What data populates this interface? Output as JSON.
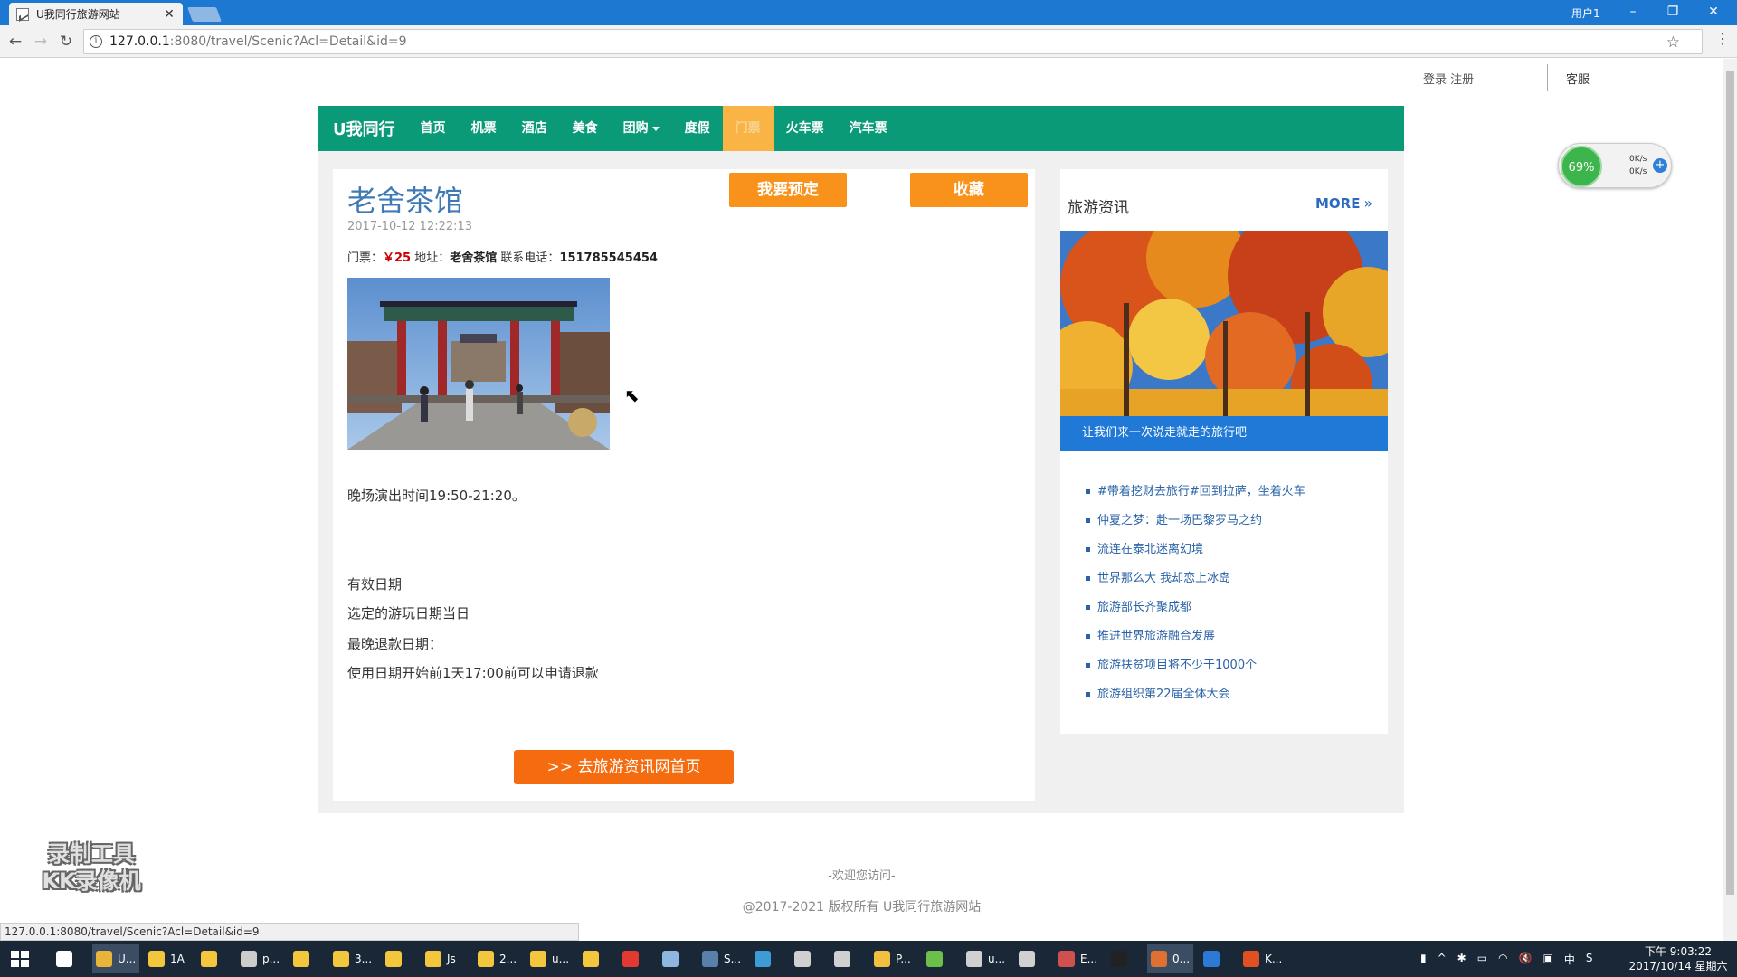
{
  "browser": {
    "tab_title": "U我同行旅游网站",
    "tab_close": "✕",
    "window_user": "用户1",
    "minimize": "–",
    "restore": "❐",
    "close": "✕",
    "url_host": "127.0.0.1",
    "url_rest": ":8080/travel/Scenic?Acl=Detail&id=9",
    "back": "←",
    "forward": "→",
    "reload": "↻",
    "star": "☆",
    "menu": "⋮",
    "status_url": "127.0.0.1:8080/travel/Scenic?Acl=Detail&id=9"
  },
  "header": {
    "login_register": "登录 注册",
    "kefu": "客服"
  },
  "navbar": {
    "brand": "U我同行",
    "items": [
      {
        "label": "首页"
      },
      {
        "label": "机票"
      },
      {
        "label": "酒店"
      },
      {
        "label": "美食"
      },
      {
        "label": "团购"
      },
      {
        "label": "度假"
      },
      {
        "label": "门票"
      },
      {
        "label": "火车票"
      },
      {
        "label": "汽车票"
      }
    ],
    "active_index": 6
  },
  "scenic": {
    "title": "老舍茶馆",
    "book_button": "我要预定",
    "favorite_button": "收藏",
    "datetime": "2017-10-12 12:22:13",
    "ticket_label": "门票：",
    "price": "￥25",
    "address_label": " 地址：",
    "address": "老舍茶馆",
    "phone_label": " 联系电话：",
    "phone": "151785545454",
    "show_time": "晚场演出时间19:50-21:20。",
    "valid_label": "有效日期",
    "valid_value": "选定的游玩日期当日",
    "refund_label": "最晚退款日期：",
    "refund_value": "使用日期开始前1天17:00前可以申请退款",
    "home_button": ">> 去旅游资讯网首页"
  },
  "sidebar": {
    "title": "旅游资讯",
    "more": "MORE",
    "more_chevron": "»",
    "caption": "让我们来一次说走就走的旅行吧",
    "news": [
      "#带着挖财去旅行#回到拉萨，坐着火车",
      "仲夏之梦：赴一场巴黎罗马之约",
      "流连在泰北迷离幻境",
      "世界那么大 我却恋上冰岛",
      "旅游部长齐聚成都",
      "推进世界旅游融合发展",
      "旅游扶贫项目将不少于1000个",
      "旅游组织第22届全体大会"
    ]
  },
  "footer": {
    "welcome": "-欢迎您访问-",
    "copyright": "@2017-2021 版权所有 U我同行旅游网站"
  },
  "overlay": {
    "speed_percent": "69%",
    "upload": "0K/s",
    "download": "0K/s",
    "plus": "+",
    "watermark_line1": "录制工具",
    "watermark_line2": "KK录像机"
  },
  "taskbar": {
    "apps": [
      {
        "label": "",
        "color": "#ffffff"
      },
      {
        "label": "U...",
        "color": "#e8b53b"
      },
      {
        "label": "1A",
        "color": "#f3c73d"
      },
      {
        "label": "",
        "color": "#f3c73d"
      },
      {
        "label": "p...",
        "color": "#cccccc"
      },
      {
        "label": "",
        "color": "#f3c73d"
      },
      {
        "label": "3...",
        "color": "#f3c73d"
      },
      {
        "label": "",
        "color": "#f3c73d"
      },
      {
        "label": "Js",
        "color": "#f3c73d"
      },
      {
        "label": "2...",
        "color": "#f3c73d"
      },
      {
        "label": "u...",
        "color": "#f3c73d"
      },
      {
        "label": "",
        "color": "#f3c73d"
      },
      {
        "label": "",
        "color": "#e23a30"
      },
      {
        "label": "",
        "color": "#8fb6e0"
      },
      {
        "label": "S...",
        "color": "#5a7fa8"
      },
      {
        "label": "",
        "color": "#3d9bd6"
      },
      {
        "label": "",
        "color": "#d0d0d0"
      },
      {
        "label": "",
        "color": "#d0d0d0"
      },
      {
        "label": "P...",
        "color": "#f0c040"
      },
      {
        "label": "",
        "color": "#6cc04a"
      },
      {
        "label": "u...",
        "color": "#d0d0d0"
      },
      {
        "label": "",
        "color": "#d0d0d0"
      },
      {
        "label": "E...",
        "color": "#d05050"
      },
      {
        "label": "",
        "color": "#222222"
      },
      {
        "label": "0...",
        "color": "#e07030"
      },
      {
        "label": "",
        "color": "#2d7ad6"
      },
      {
        "label": "K...",
        "color": "#e05020"
      }
    ],
    "tray": [
      "▮",
      "^",
      "✱",
      "▭",
      "◠",
      "🔇",
      "▣",
      "中",
      "S"
    ],
    "time": "下午 9:03:22",
    "date": "2017/10/14 星期六"
  }
}
